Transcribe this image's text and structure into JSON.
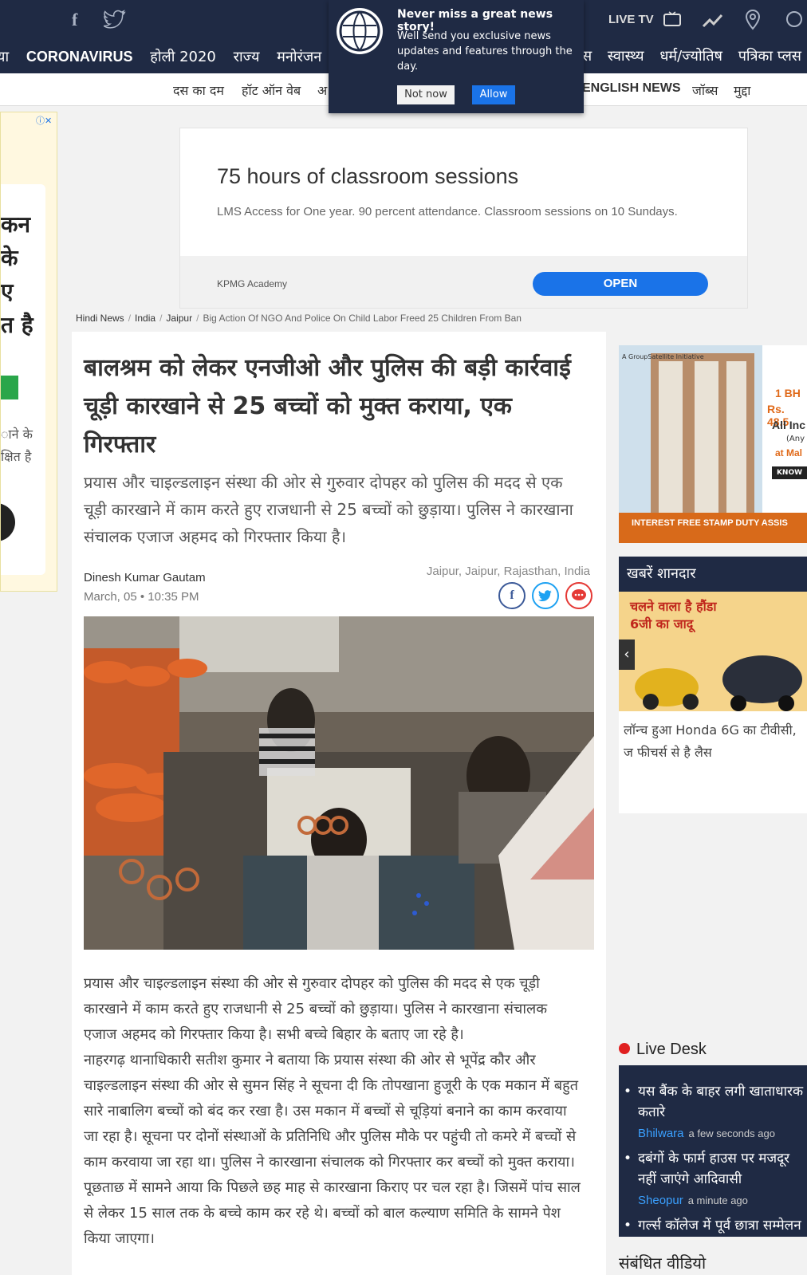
{
  "topbar": {
    "facebook_glyph": "f",
    "livetv": "LIVE TV"
  },
  "nav": {
    "items": [
      "या",
      "CORONAVIRUS",
      "होली 2020",
      "राज्य",
      "मनोरंजन",
      "र",
      "नेस",
      "स्वास्थ्य",
      "धर्म/ज्योतिष",
      "पत्रिका प्लस"
    ]
  },
  "subnav": {
    "items": [
      "दस का दम",
      "हॉट ऑन वेब",
      "अ",
      "ENGLISH NEWS",
      "जॉब्स",
      "मुद्दा"
    ]
  },
  "popup": {
    "title": "Never miss a great news story!",
    "text": "Well send you exclusive news updates and features through the day.",
    "not_now": "Not now",
    "allow": "Allow"
  },
  "leftad": {
    "lines": [
      "कन",
      "के",
      "ए",
      "त है"
    ],
    "small": [
      "ाने के",
      "क्षित है"
    ]
  },
  "ad": {
    "title": "75 hours of classroom sessions",
    "text": "LMS Access for One year. 90 percent attendance. Classroom sessions on 10 Sundays.",
    "brand": "KPMG Academy",
    "button": "OPEN"
  },
  "breadcrumb": {
    "items": [
      "Hindi News",
      "India",
      "Jaipur"
    ],
    "current": "Big Action Of NGO And Police On Child Labor Freed 25 Children From Ban"
  },
  "article": {
    "headline": "बालश्रम को लेकर एनजीओ और पुलिस की बड़ी कार्रवाई चूड़ी कारखाने से 25 बच्चों को मुक्त कराया, एक गिरफ्तार",
    "summary": "प्रयास और चाइल्डलाइन संस्था की ओर से गुरुवार दोपहर को पुलिस की मदद से एक चूड़ी कारखाने में काम करते हुए राजधानी से 25 बच्चों को छुड़ाया। पुलिस ने कारखाना संचालक एजाज अहमद को गिरफ्तार किया है।",
    "author": "Dinesh Kumar Gautam",
    "date": "March, 05 • 10:35 PM",
    "location": "Jaipur, Jaipur, Rajasthan, India",
    "paragraph1": "प्रयास और चाइल्डलाइन संस्था की ओर से गुरुवार दोपहर को पुलिस की मदद से एक चूड़ी कारखाने में काम करते हुए राजधानी से 25 बच्चों को छुड़ाया। पुलिस ने कारखाना संचालक एजाज अहमद को गिरफ्तार किया है। सभी बच्चे बिहार के बताए जा रहे है।",
    "paragraph2": "नाहरगढ़ थानाधिकारी सतीश कुमार ने बताया कि प्रयास संस्था की ओर से भूपेंद्र कौर और चाइल्डलाइन संस्था की ओर से सुमन सिंह ने सूचना दी कि तोपखाना हुजूरी के एक मकान में बहुत सारे नाबालिग बच्चों को बंद कर रखा है। उस मकान में बच्चों से चूड़ियां बनाने का काम करवाया जा रहा है। सूचना पर दोनों संस्थाओं के प्रतिनिधि और पुलिस मौके पर पहुंची तो कमरे में बच्चों से काम करवाया जा रहा था। पुलिस ने कारखाना संचालक को गिरफ्तार कर बच्चों को मुक्त कराया। पूछताछ में सामने आया कि पिछले छह माह से कारखाना किराए पर चल रहा है। जिसमें पांच साल से लेकर 15 साल तक के बच्चे काम कर रहे थे। बच्चों को बाल कल्याण समिति के सामने पेश किया जाएगा।"
  },
  "sidead": {
    "brand": "A GroupSatellite Initiative",
    "line1": "1 BH",
    "line2": "Rs. 48.5",
    "line3": "All Inc",
    "line4": "(Any",
    "line5": "at Mal",
    "know": "KNOW",
    "footer": "INTEREST FREE STAMP DUTY ASSIS"
  },
  "khabar": {
    "heading": "खबरें शानदार",
    "promo": "चलने वाला है हौंडा 6जी का जादू",
    "caption": "लॉन्च हुआ Honda 6G का टीवीसी, ज फीचर्स से है लैस"
  },
  "livedesk": {
    "heading": "Live Desk",
    "items": [
      {
        "text": "यस बैंक के बाहर लगी खाताधारक कतारे",
        "city": "Bhilwara",
        "ago": "a few seconds ago"
      },
      {
        "text": "दबंगों के फार्म हाउस पर मजदूर नहीं जाएंगे आदिवासी",
        "city": "Sheopur",
        "ago": "a minute ago"
      },
      {
        "text": "गर्ल्स कॉलेज में पूर्व छात्रा सम्मेलन",
        "city": "",
        "ago": ""
      }
    ]
  },
  "related_videos": "संबंधित वीडियो",
  "colors": {
    "nav_bg": "#1f2a44",
    "accent_blue": "#1a73e8",
    "live_dot": "#e02020"
  }
}
